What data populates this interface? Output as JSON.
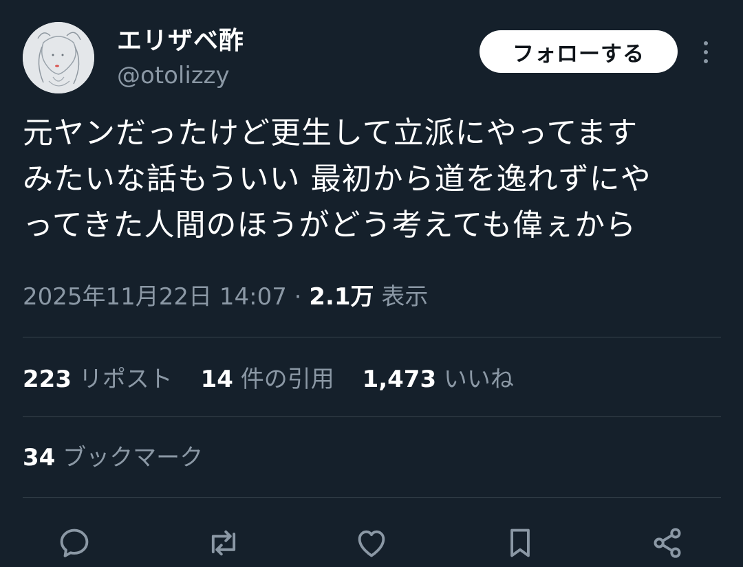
{
  "user": {
    "display_name": "エリザベ酢",
    "handle": "@otolizzy"
  },
  "follow_button": "フォローする",
  "tweet": {
    "lines": [
      "元ヤンだったけど更生して立派にやってます",
      "みたいな話もういい 最初から道を逸れずにや",
      "ってきた人間のほうがどう考えても偉ぇから"
    ]
  },
  "meta": {
    "timestamp": "2025年11月22日 14:07",
    "separator": "·",
    "views_count": "2.1万",
    "views_label": "表示"
  },
  "stats": {
    "reposts": {
      "count": "223",
      "label": "リポスト"
    },
    "quotes": {
      "count": "14",
      "label": "件の引用"
    },
    "likes": {
      "count": "1,473",
      "label": "いいね"
    },
    "bookmarks": {
      "count": "34",
      "label": "ブックマーク"
    }
  },
  "actions": [
    "reply-icon",
    "repost-icon",
    "like-icon",
    "bookmark-icon",
    "share-icon"
  ],
  "colors": {
    "background": "#15202b",
    "text": "#ffffff",
    "secondary": "#8b98a5",
    "divider": "#38444d"
  }
}
